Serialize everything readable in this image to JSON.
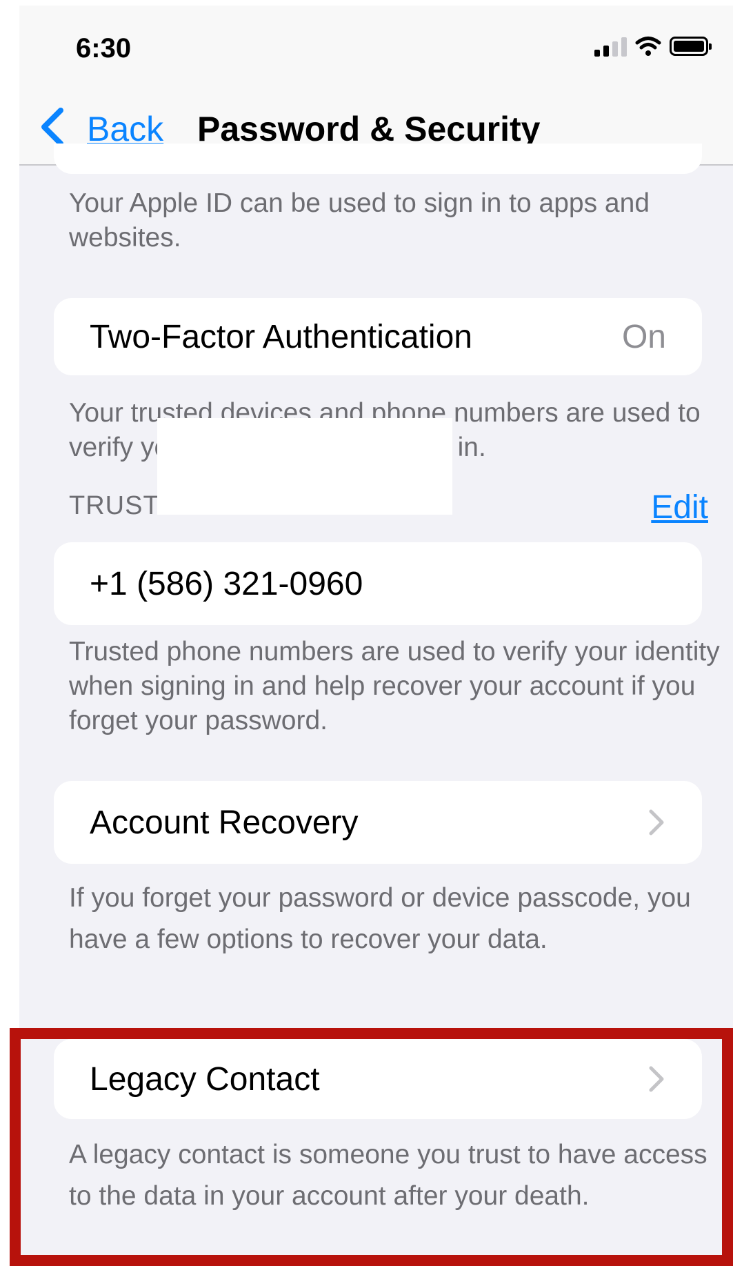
{
  "status_bar": {
    "time": "6:30"
  },
  "nav": {
    "back_label": "Back",
    "title": "Password & Security"
  },
  "apple_id_footer": "Your Apple ID can be used to sign in to apps and websites.",
  "two_factor": {
    "label": "Two-Factor Authentication",
    "value": "On",
    "footer": "Your trusted devices and phone numbers are used to verify your identity when signing in."
  },
  "trusted_phone": {
    "header": "TRUSTED PHONE NUMBER",
    "edit_label": "Edit",
    "number": "+1 (586) 321-0960",
    "footer": "Trusted phone numbers are used to verify your identity when signing in and help recover your account if you forget your password."
  },
  "account_recovery": {
    "label": "Account Recovery",
    "footer": "If you forget your password or device passcode, you have a few options to recover your data."
  },
  "legacy_contact": {
    "label": "Legacy Contact",
    "footer": "A legacy contact is someone you trust to have access to the data in your account after your death."
  },
  "colors": {
    "accent": "#0a84ff",
    "highlight": "#b7120c",
    "background": "#f2f2f7"
  },
  "icons": [
    "back-chevron-icon",
    "signal-icon",
    "wifi-icon",
    "battery-icon",
    "chevron-right-icon"
  ]
}
